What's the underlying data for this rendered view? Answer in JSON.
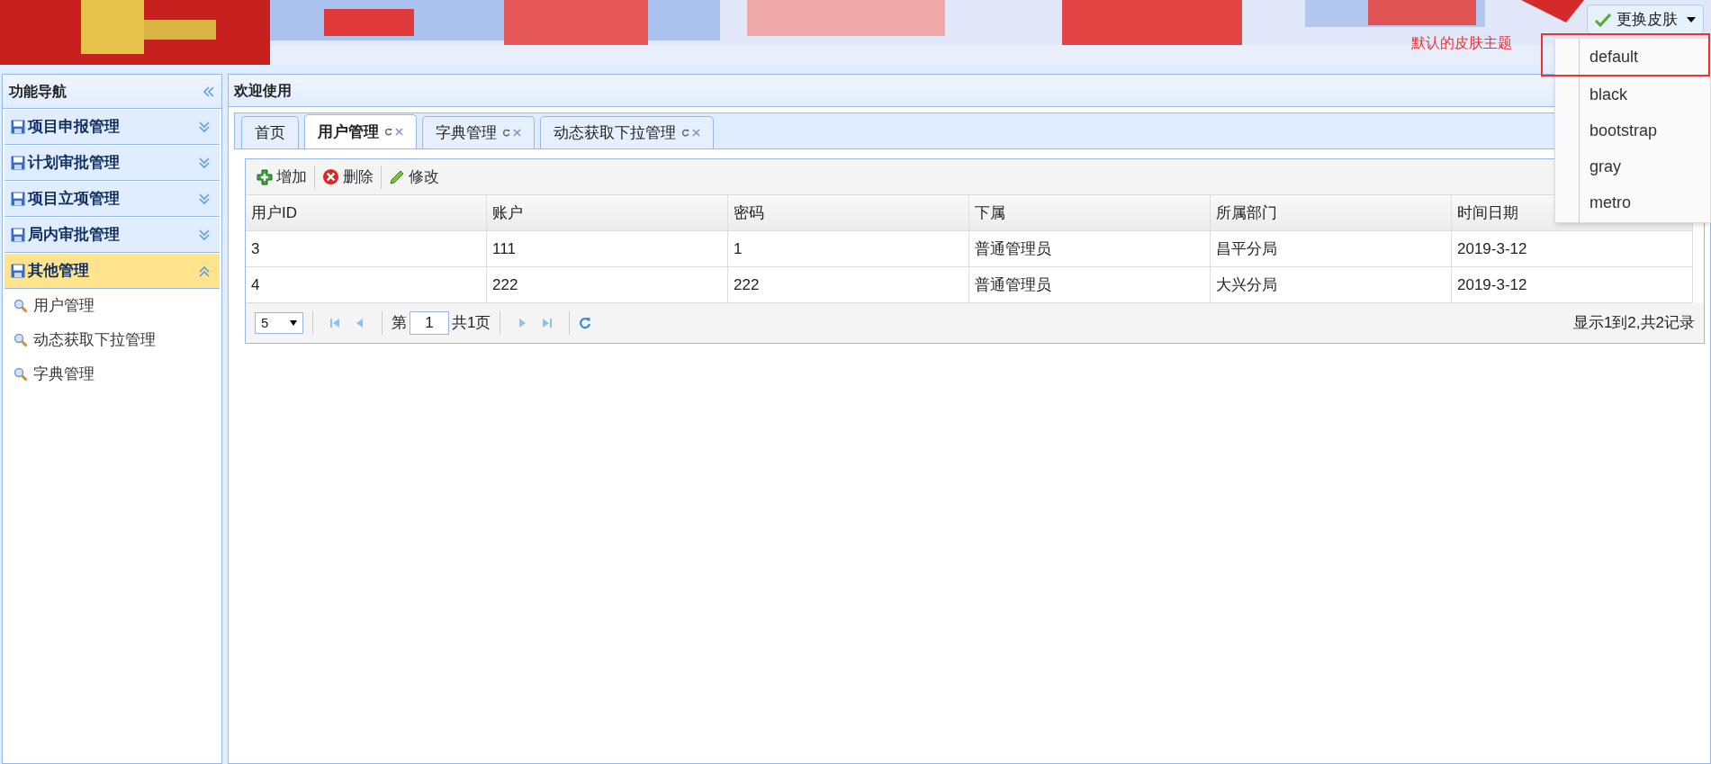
{
  "skin_button": {
    "label": "更换皮肤"
  },
  "annotation": "默认的皮肤主题",
  "skin_menu": [
    {
      "label": "default",
      "annotated": true
    },
    {
      "label": "black",
      "annotated": false
    },
    {
      "label": "bootstrap",
      "annotated": false
    },
    {
      "label": "gray",
      "annotated": false
    },
    {
      "label": "metro",
      "annotated": false
    }
  ],
  "sidebar": {
    "title": "功能导航",
    "groups": [
      {
        "label": "项目申报管理",
        "expanded": false
      },
      {
        "label": "计划审批管理",
        "expanded": false
      },
      {
        "label": "项目立项管理",
        "expanded": false
      },
      {
        "label": "局内审批管理",
        "expanded": false
      },
      {
        "label": "其他管理",
        "expanded": true,
        "children": [
          "用户管理",
          "动态获取下拉管理",
          "字典管理"
        ]
      }
    ]
  },
  "main": {
    "title": "欢迎使用",
    "tabs": [
      {
        "label": "首页",
        "selected": false,
        "closable": false
      },
      {
        "label": "用户管理",
        "selected": true,
        "closable": true
      },
      {
        "label": "字典管理",
        "selected": false,
        "closable": true
      },
      {
        "label": "动态获取下拉管理",
        "selected": false,
        "closable": true
      }
    ],
    "toolbar": [
      {
        "kind": "add",
        "label": "增加"
      },
      {
        "kind": "delete",
        "label": "删除"
      },
      {
        "kind": "edit",
        "label": "修改"
      }
    ],
    "table": {
      "columns": [
        "用户ID",
        "账户",
        "密码",
        "下属",
        "所属部门",
        "时间日期"
      ],
      "rows": [
        [
          "3",
          "111",
          "1",
          "普通管理员",
          "昌平分局",
          "2019-3-12"
        ],
        [
          "4",
          "222",
          "222",
          "普通管理员",
          "大兴分局",
          "2019-3-12"
        ]
      ]
    },
    "pager": {
      "page_size": "5",
      "page_prefix": "第",
      "page": "1",
      "total_pages": "共1页",
      "summary": "显示1到2,共2记录"
    }
  }
}
